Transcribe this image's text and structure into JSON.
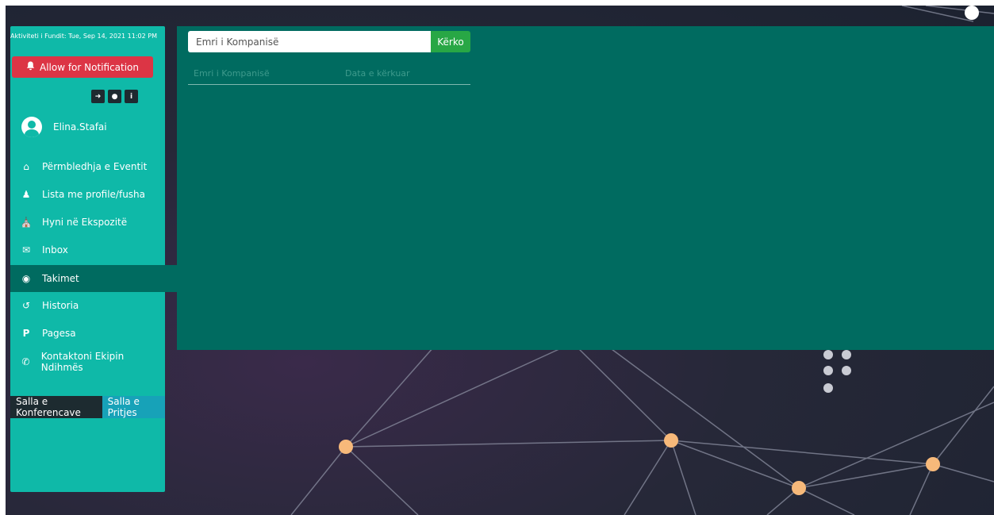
{
  "sidebar": {
    "last_activity": "Aktiviteti i Fundit: Tue, Sep 14, 2021 11:02 PM",
    "notification_button": "Allow for Notification",
    "icons": [
      "sign-out-icon",
      "globe-icon",
      "info-icon"
    ],
    "user": {
      "name": "Elina.Stafai"
    },
    "items": [
      {
        "label": "Përmbledhja e Eventit",
        "icon": "home-icon"
      },
      {
        "label": "Lista me profile/fusha",
        "icon": "user-icon"
      },
      {
        "label": "Hyni në Ekspozitë",
        "icon": "bank-icon"
      },
      {
        "label": "Inbox",
        "icon": "envelope-icon"
      },
      {
        "label": "Takimet",
        "icon": "camera-icon",
        "active": true
      },
      {
        "label": "Historia",
        "icon": "history-icon"
      },
      {
        "label": "Pagesa",
        "icon": "paypal-icon"
      },
      {
        "label": "Kontaktoni Ekipin Ndihmës",
        "icon": "phone-icon"
      }
    ],
    "room_tabs": [
      "Salla e Konferencave",
      "Salla e Pritjes"
    ]
  },
  "main": {
    "search": {
      "placeholder": "Emri i Kompanisë",
      "button": "Kërko"
    },
    "table": {
      "columns": [
        "Emri i Kompanisë",
        "Data e kërkuar"
      ]
    }
  },
  "colors": {
    "sidebar": "#0fb9a8",
    "main": "#006b60",
    "notification": "#dc3545",
    "search_button": "#28a745",
    "tab_active": "#17a2b8"
  }
}
